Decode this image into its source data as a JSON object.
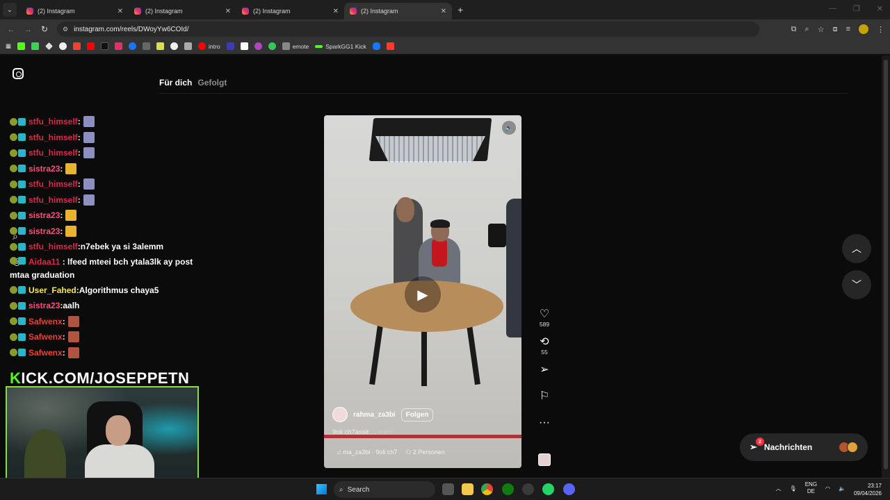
{
  "browser": {
    "tabs": [
      {
        "title": "(2) Instagram",
        "active": false
      },
      {
        "title": "(2) Instagram",
        "active": false
      },
      {
        "title": "(2) Instagram",
        "active": false
      },
      {
        "title": "(2) Instagram",
        "active": true
      }
    ],
    "url": "instagram.com/reels/DWoyYw6COId/",
    "bookmarks": [
      "intro",
      "emote",
      "SparkGG1 Kick"
    ]
  },
  "instagram": {
    "feed_tabs": {
      "for_you": "Für dich",
      "following": "Gefolgt"
    },
    "reel": {
      "author": "rahma_za3bi",
      "follow_label": "Folgen",
      "caption": "9oli ch7assit ...",
      "more_label": "mehr",
      "audio": "ma_za3bi · 9oli ch7",
      "people": "2 Personen"
    },
    "actions": {
      "likes": "589",
      "reposts": "55"
    },
    "messages": {
      "label": "Nachrichten",
      "badge": "2"
    }
  },
  "stream_overlay": {
    "chat": [
      {
        "user": "stfu_himself",
        "color": "#e0264b",
        "text": ""
      },
      {
        "user": "stfu_himself",
        "color": "#e0264b",
        "text": ""
      },
      {
        "user": "stfu_himself",
        "color": "#e0264b",
        "text": ""
      },
      {
        "user": "sistra23",
        "color": "#ff4f7b",
        "text": ""
      },
      {
        "user": "stfu_himself",
        "color": "#e0264b",
        "text": ""
      },
      {
        "user": "stfu_himself",
        "color": "#e0264b",
        "text": ""
      },
      {
        "user": "sistra23",
        "color": "#ff4f7b",
        "text": ""
      },
      {
        "user": "sistra23",
        "color": "#ff4f7b",
        "text": ""
      },
      {
        "user": "stfu_himself",
        "color": "#e0264b",
        "text": "n7ebek ya si 3alemm"
      },
      {
        "user": "Aidaa11",
        "color": "#e0264b",
        "text": "lfeed mteei bch ytala3lk ay post mtaa graduation"
      },
      {
        "user": "User_Fahed",
        "color": "#f6e65a",
        "text": "Algorithmus chaya5"
      },
      {
        "user": "sistra23",
        "color": "#ff4f7b",
        "text": "aalh"
      },
      {
        "user": "Safwenx",
        "color": "#ff3b30",
        "text": ""
      },
      {
        "user": "Safwenx",
        "color": "#ff3b30",
        "text": ""
      },
      {
        "user": "Safwenx",
        "color": "#ff3b30",
        "text": ""
      }
    ],
    "kick_prefix": "K",
    "kick_rest": "ICK.COM/JOSEPPETN"
  },
  "taskbar": {
    "search_placeholder": "Search",
    "lang_top": "ENG",
    "lang_bottom": "DE",
    "time": "23:17",
    "date": "09/04/2026"
  }
}
